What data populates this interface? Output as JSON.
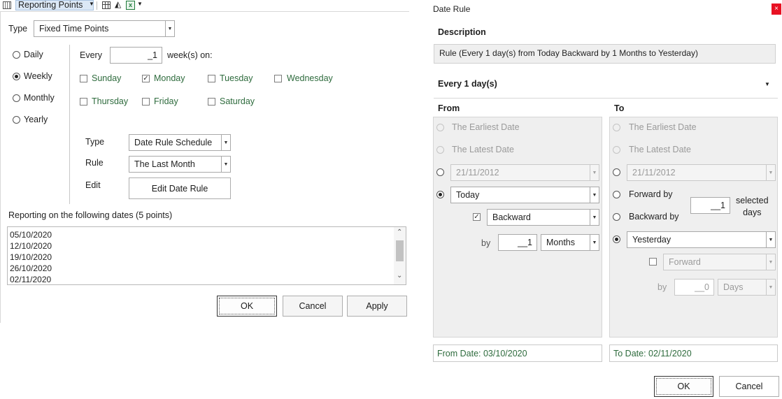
{
  "left": {
    "toolbar": {
      "title": "Reporting Points"
    },
    "type_label": "Type",
    "type_value": "Fixed Time Points",
    "frequency": [
      "Daily",
      "Weekly",
      "Monthly",
      "Yearly"
    ],
    "frequency_selected": "Weekly",
    "every_label": "Every",
    "every_value": "_1",
    "weeks_on_label": "week(s) on:",
    "days": [
      {
        "label": "Sunday",
        "checked": false
      },
      {
        "label": "Monday",
        "checked": true
      },
      {
        "label": "Tuesday",
        "checked": false
      },
      {
        "label": "Wednesday",
        "checked": false
      },
      {
        "label": "Thursday",
        "checked": false
      },
      {
        "label": "Friday",
        "checked": false
      },
      {
        "label": "Saturday",
        "checked": false
      }
    ],
    "sched_type_label": "Type",
    "sched_type_value": "Date Rule Schedule",
    "rule_label": "Rule",
    "rule_value": "The Last Month",
    "edit_label": "Edit",
    "edit_button": "Edit Date Rule",
    "reporting_label": "Reporting on the following dates (5 points)",
    "dates": [
      "05/10/2020",
      "12/10/2020",
      "19/10/2020",
      "26/10/2020",
      "02/11/2020"
    ],
    "ok": "OK",
    "cancel": "Cancel",
    "apply": "Apply"
  },
  "right": {
    "title": "Date Rule",
    "close": "×",
    "description_label": "Description",
    "description": "Rule (Every 1 day(s) from Today Backward by 1 Months to Yesterday)",
    "every_header": "Every 1 day(s)",
    "from": {
      "header": "From",
      "earliest": "The Earliest Date",
      "latest": "The Latest Date",
      "date_value": "21/11/2012",
      "today_value": "Today",
      "direction_value": "Backward",
      "by_label": "by",
      "by_value": "__1",
      "unit_value": "Months"
    },
    "to": {
      "header": "To",
      "earliest": "The Earliest Date",
      "latest": "The Latest Date",
      "date_value": "21/11/2012",
      "forward_by": "Forward by",
      "backward_by": "Backward by",
      "selected_value": "__1",
      "selected_days": "selected\ndays",
      "yesterday_value": "Yesterday",
      "direction_value": "Forward",
      "by_label": "by",
      "by_value": "__0",
      "unit_value": "Days"
    },
    "from_date": "From Date: 03/10/2020",
    "to_date": "To Date: 02/11/2020",
    "ok": "OK",
    "cancel": "Cancel"
  }
}
